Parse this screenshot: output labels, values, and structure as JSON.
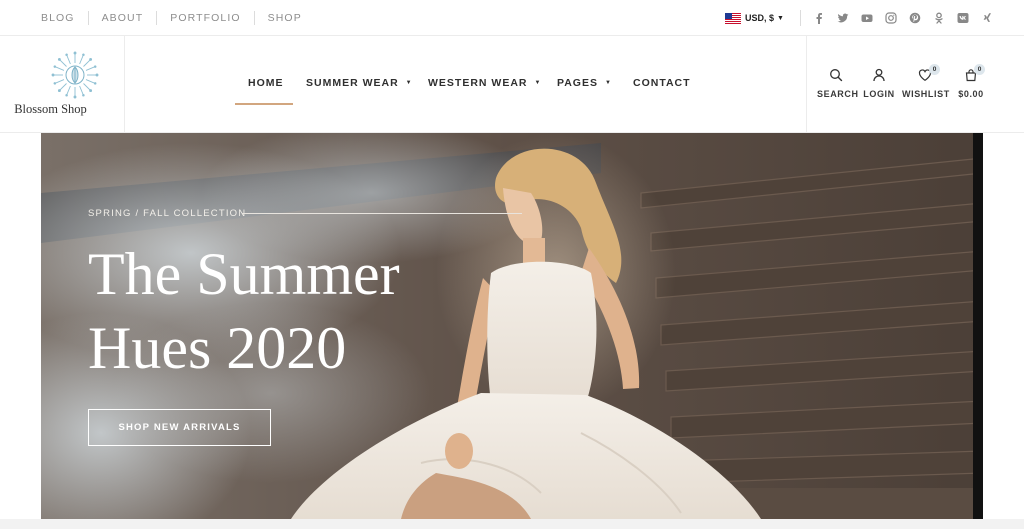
{
  "topbar": {
    "links": [
      "BLOG",
      "ABOUT",
      "PORTFOLIO",
      "SHOP"
    ],
    "currency": "USD, $",
    "socials": [
      "facebook-icon",
      "twitter-icon",
      "youtube-icon",
      "instagram-icon",
      "pinterest-icon",
      "odnoklassniki-icon",
      "vk-icon",
      "xing-icon"
    ]
  },
  "header": {
    "logo_text": "Blossom Shop",
    "nav": [
      {
        "label": "HOME",
        "active": true
      },
      {
        "label": "SUMMER WEAR",
        "dropdown": true
      },
      {
        "label": "WESTERN WEAR",
        "dropdown": true
      },
      {
        "label": "PAGES",
        "dropdown": true
      },
      {
        "label": "CONTACT"
      }
    ],
    "actions": {
      "search": "SEARCH",
      "login": "LOGIN",
      "wishlist": "WISHLIST",
      "wishlist_count": "0",
      "cart": "$0.00",
      "cart_count": "0"
    }
  },
  "hero": {
    "eyebrow": "SPRING / FALL COLLECTION",
    "title_line1": "The Summer",
    "title_line2": "Hues 2020",
    "button": "SHOP NEW ARRIVALS"
  },
  "colors": {
    "accent": "#d2a67f",
    "text": "#2f2f2f",
    "muted": "#8d8d8d",
    "logo": "#7fb3c8"
  }
}
